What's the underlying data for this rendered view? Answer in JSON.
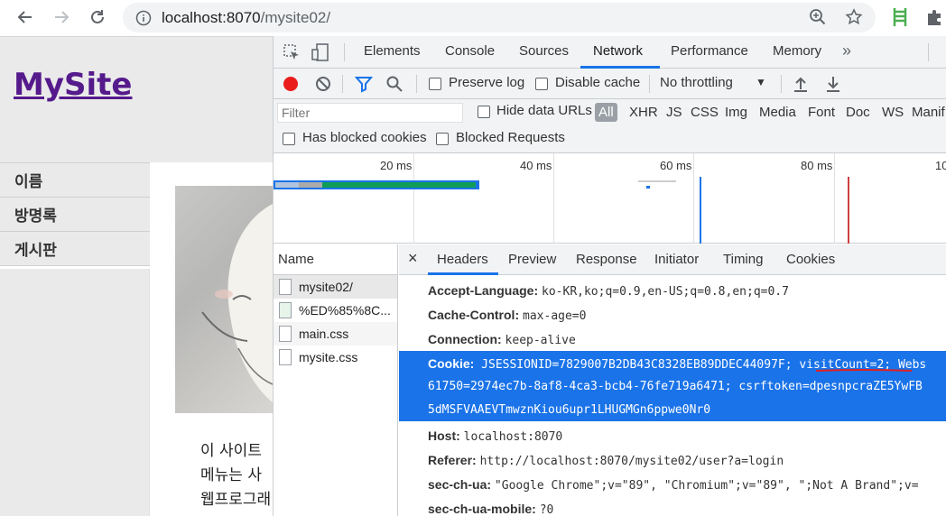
{
  "browser": {
    "url_host": "localhost:8070",
    "url_path": "/mysite02/"
  },
  "page": {
    "site_title": "MySite",
    "nav": [
      "이름",
      "방명록",
      "게시판"
    ],
    "content_lines": [
      "이 사이트",
      "메뉴는 사",
      "웹프로그래"
    ]
  },
  "devtools": {
    "tabs": [
      "Elements",
      "Console",
      "Sources",
      "Network",
      "Performance",
      "Memory"
    ],
    "active_tab": "Network",
    "toolbar": {
      "preserve_log": "Preserve log",
      "disable_cache": "Disable cache",
      "throttling": "No throttling"
    },
    "filter": {
      "placeholder": "Filter",
      "hide_data_urls": "Hide data URLs",
      "types": [
        "All",
        "XHR",
        "JS",
        "CSS",
        "Img",
        "Media",
        "Font",
        "Doc",
        "WS",
        "Manif"
      ],
      "blocked_cookies": "Has blocked cookies",
      "blocked_requests": "Blocked Requests"
    },
    "timeline_ticks": [
      "20 ms",
      "40 ms",
      "60 ms",
      "80 ms",
      "10"
    ],
    "names_header": "Name",
    "requests": [
      "mysite02/",
      "%ED%85%8C...",
      "main.css",
      "mysite.css"
    ],
    "detail_close": "×",
    "detail_tabs": [
      "Headers",
      "Preview",
      "Response",
      "Initiator",
      "Timing",
      "Cookies"
    ],
    "headers": [
      {
        "k": "Accept-Language:",
        "v": "ko-KR,ko;q=0.9,en-US;q=0.8,en;q=0.7"
      },
      {
        "k": "Cache-Control:",
        "v": "max-age=0"
      },
      {
        "k": "Connection:",
        "v": "keep-alive"
      }
    ],
    "cookie": {
      "k": "Cookie:",
      "line1_a": "JSESSIONID=7829007B2DB43C8328EB89DDEC44097F;",
      "line1_b": "visitCount=2;",
      "line1_c": "Webs",
      "line2": "61750=2974ec7b-8af8-4ca3-bcb4-76fe719a6471; csrftoken=dpesnpcraZE5YwFB",
      "line3": "5dMSFVAAEVTmwznKiou6upr1LHUGMGn6ppwe0Nr0"
    },
    "headers_after": [
      {
        "k": "Host:",
        "v": "localhost:8070"
      },
      {
        "k": "Referer:",
        "v": "http://localhost:8070/mysite02/user?a=login"
      },
      {
        "k": "sec-ch-ua:",
        "v": "\"Google Chrome\";v=\"89\", \"Chromium\";v=\"89\", \";Not A Brand\";v="
      },
      {
        "k": "sec-ch-ua-mobile:",
        "v": "?0"
      }
    ]
  },
  "colors": {
    "accent": "#1a73e8",
    "record": "#ea1c1c",
    "link_visited": "#551a8b"
  }
}
